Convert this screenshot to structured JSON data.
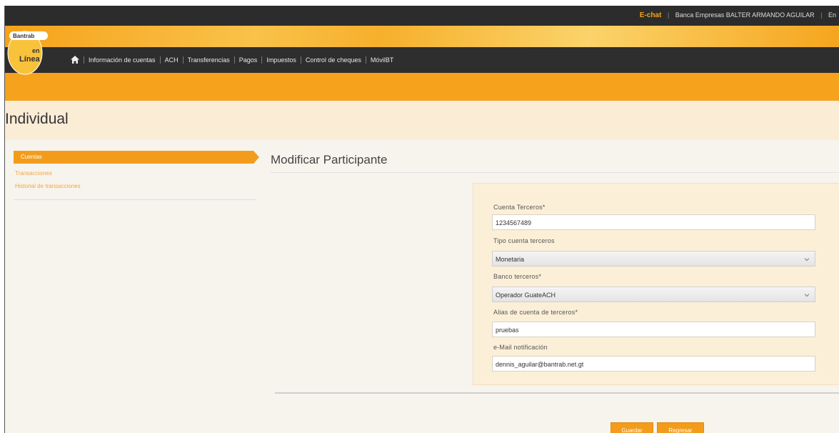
{
  "topbar": {
    "chat_label": "E-chat",
    "user_label": "Banca Empresas BALTER ARMANDO AGUILAR",
    "extra": "En"
  },
  "logo": {
    "brand": "Bantrab",
    "line1": "en",
    "line2": "Línea"
  },
  "nav": {
    "items": [
      "Información de cuentas",
      "ACH",
      "Transferencias",
      "Pagos",
      "Impuestos",
      "Control de cheques",
      "MóvilBT"
    ]
  },
  "page": {
    "title": "Individual"
  },
  "sidebar": {
    "active": "Cuentas",
    "items": [
      "Transacciones",
      "Historial de transacciones"
    ]
  },
  "main": {
    "title": "Modificar Participante"
  },
  "form": {
    "cuenta_label": "Cuenta Terceros*",
    "cuenta_value": "1234567489",
    "tipo_label": "Tipo cuenta terceros",
    "tipo_value": "Monetaria",
    "banco_label": "Banco terceros*",
    "banco_value": "Operador GuateACH",
    "alias_label": "Alias de cuenta de terceros*",
    "alias_value": "pruebas",
    "email_label": "e-Mail notificación",
    "email_value": "dennis_aguilar@bantrab.net.gt"
  },
  "actions": {
    "save_label": "Guardar",
    "back_label": "Regresar"
  },
  "colors": {
    "accent": "#f39c1b",
    "dark_bar": "#2e2e2e",
    "form_bg": "#fcefd8"
  }
}
